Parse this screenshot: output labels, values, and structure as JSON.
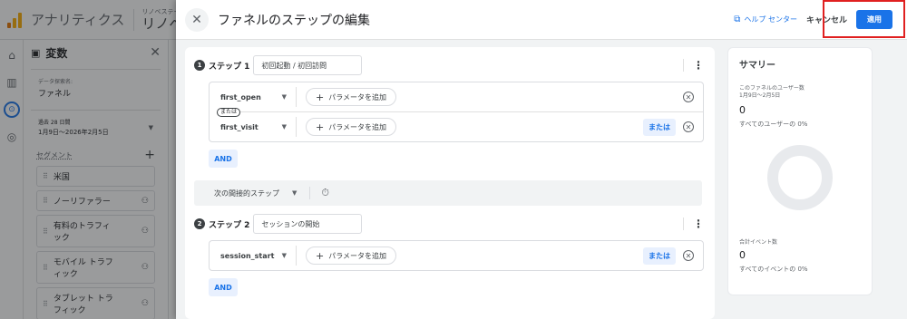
{
  "app": {
    "title": "アナリティクス",
    "property_small": "リノベステーション",
    "property_name": "リノベステ"
  },
  "variables_panel": {
    "title": "変数",
    "close": "✕",
    "exploration_label": "データ探索名:",
    "exploration_name": "ファネル",
    "date_label": "過去 28 日間",
    "date_range": "1月9日～2026年2月5日",
    "segments_label": "セグメント",
    "segments": [
      {
        "label": "米国",
        "has_user_icon": false
      },
      {
        "label": "ノーリファラー",
        "has_user_icon": true
      },
      {
        "label": "有料のトラフィック",
        "has_user_icon": true
      },
      {
        "label": "モバイル トラフィック",
        "has_user_icon": true
      },
      {
        "label": "タブレット トラフィック",
        "has_user_icon": true
      }
    ]
  },
  "drawer": {
    "title": "ファネルのステップの編集",
    "help_label": "ヘルプ センター",
    "cancel_label": "キャンセル",
    "apply_label": "適用"
  },
  "steps": [
    {
      "number": "1",
      "label": "ステップ 1",
      "name": "初回起動 / 初回訪問",
      "conditions": [
        {
          "event": "first_open",
          "add_param": "パラメータを追加",
          "show_or": false
        },
        {
          "event": "first_visit",
          "add_param": "パラメータを追加",
          "show_or": true
        }
      ],
      "or_divider": "または",
      "and_label": "AND"
    },
    {
      "number": "2",
      "label": "ステップ 2",
      "name": "セッションの開始",
      "conditions": [
        {
          "event": "session_start",
          "add_param": "パラメータを追加",
          "show_or": true
        }
      ],
      "and_label": "AND"
    }
  ],
  "or_label": "または",
  "indirect_step": {
    "label": "次の間接的ステップ"
  },
  "summary": {
    "title": "サマリー",
    "users_label_line1": "このファネルのユーザー数",
    "users_label_line2": "1月9日～2月5日",
    "users_value": "0",
    "users_pct": "すべてのユーザーの 0%",
    "events_label": "合計イベント数",
    "events_value": "0",
    "events_pct": "すべてのイベントの 0%"
  },
  "colors": {
    "accent": "#1a73e8",
    "highlight_box": "#e02020"
  }
}
